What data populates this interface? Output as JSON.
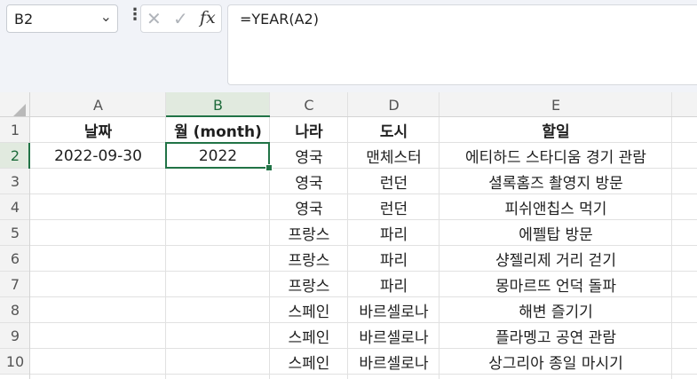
{
  "formula_bar": {
    "name_box": "B2",
    "name_box_chevron_icon": "chevron-down-icon",
    "more_icon": "more-vertical-icon",
    "cancel_icon": "cancel-x-icon",
    "enter_icon": "enter-check-icon",
    "fx_label": "fx",
    "formula": "=YEAR(A2)"
  },
  "columns": [
    "A",
    "B",
    "C",
    "D",
    "E"
  ],
  "rows": [
    "1",
    "2",
    "3",
    "4",
    "5",
    "6",
    "7",
    "8",
    "9",
    "10"
  ],
  "selected": {
    "column": "B",
    "row": "2"
  },
  "colors": {
    "selection": "#217346",
    "header_bg": "#f3f3f3",
    "selected_header_bg": "#e1eadf"
  },
  "cells": [
    [
      "날짜",
      "월 (month)",
      "나라",
      "도시",
      "할일"
    ],
    [
      "2022-09-30",
      "2022",
      "영국",
      "맨체스터",
      "에티하드 스타디움 경기 관람"
    ],
    [
      "",
      "",
      "영국",
      "런던",
      "셜록홈즈 촬영지 방문"
    ],
    [
      "",
      "",
      "영국",
      "런던",
      "피쉬앤칩스 먹기"
    ],
    [
      "",
      "",
      "프랑스",
      "파리",
      "에펠탑 방문"
    ],
    [
      "",
      "",
      "프랑스",
      "파리",
      "샹젤리제 거리 걷기"
    ],
    [
      "",
      "",
      "프랑스",
      "파리",
      "몽마르뜨 언덕 돌파"
    ],
    [
      "",
      "",
      "스페인",
      "바르셀로나",
      "해변 즐기기"
    ],
    [
      "",
      "",
      "스페인",
      "바르셀로나",
      "플라멩고 공연 관람"
    ],
    [
      "",
      "",
      "스페인",
      "바르셀로나",
      "상그리아 종일 마시기"
    ]
  ]
}
